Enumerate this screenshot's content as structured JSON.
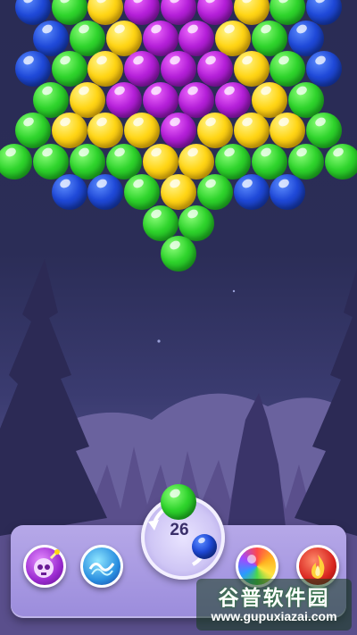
{
  "game": {
    "shots_remaining": "26",
    "next_bubble_color": "blue",
    "loaded_bubble_color": "green"
  },
  "powerups": [
    {
      "name": "bomb-powerup",
      "icon": "skull-bomb-icon"
    },
    {
      "name": "lightning-powerup",
      "icon": "lightning-icon"
    },
    {
      "name": "rainbow-powerup",
      "icon": "rainbow-ball-icon"
    },
    {
      "name": "fireball-powerup",
      "icon": "fire-icon"
    }
  ],
  "bubble_rows": [
    [
      "blue",
      "green",
      "yellow",
      "purple",
      "purple",
      "purple",
      "yellow",
      "green",
      "blue"
    ],
    [
      "blue",
      "green",
      "yellow",
      "purple",
      "purple",
      "yellow",
      "green",
      "blue"
    ],
    [
      "blue",
      "green",
      "yellow",
      "purple",
      "purple",
      "purple",
      "yellow",
      "green",
      "blue"
    ],
    [
      "green",
      "yellow",
      "purple",
      "purple",
      "purple",
      "purple",
      "yellow",
      "green"
    ],
    [
      "green",
      "yellow",
      "yellow",
      "yellow",
      "purple",
      "yellow",
      "yellow",
      "yellow",
      "green"
    ],
    [
      "green",
      "green",
      "green",
      "green",
      "yellow",
      "yellow",
      "green",
      "green",
      "green",
      "green"
    ],
    [
      "blue",
      "blue",
      "green",
      "yellow",
      "green",
      "blue",
      "blue"
    ],
    [
      "green",
      "green"
    ],
    [
      "green"
    ]
  ],
  "colors": {
    "green": "#2fd42c",
    "blue": "#1f49d8",
    "purple": "#b41fd8",
    "yellow": "#ffd515"
  },
  "watermark": {
    "title": "谷普软件园",
    "url": "www.gupuxiazai.com"
  }
}
